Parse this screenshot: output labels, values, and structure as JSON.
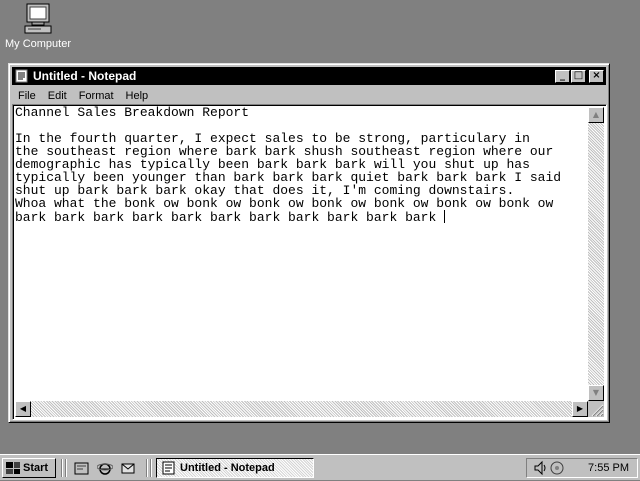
{
  "desktop": {
    "icons": [
      {
        "label": "My Computer",
        "icon": "my-computer-icon"
      }
    ]
  },
  "window": {
    "title": "Untitled - Notepad",
    "controls": {
      "minimize": "_",
      "maximize": "□",
      "close": "×"
    },
    "menu": [
      "File",
      "Edit",
      "Format",
      "Help"
    ],
    "content": "Channel Sales Breakdown Report\n\nIn the fourth quarter, I expect sales to be strong, particulary in\nthe southeast region where bark bark shush southeast region where our\ndemographic has typically been bark bark bark will you shut up has\ntypically been younger than bark bark bark quiet bark bark bark I said\nshut up bark bark bark okay that does it, I'm coming downstairs.\nWhoa what the bonk ow bonk ow bonk ow bonk ow bonk ow bonk ow bonk ow\nbark bark bark bark bark bark bark bark bark bark bark "
  },
  "taskbar": {
    "start_label": "Start",
    "quick_launch": [
      "show-desktop-icon",
      "internet-explorer-icon",
      "outlook-express-icon"
    ],
    "task_button_label": "Untitled - Notepad",
    "clock": "7:55 PM",
    "tray_icons": [
      "volume-icon",
      "network-icon"
    ]
  },
  "colors": {
    "desktop": "#808080",
    "titlebar": "#000000",
    "face": "#c0c0c0"
  }
}
